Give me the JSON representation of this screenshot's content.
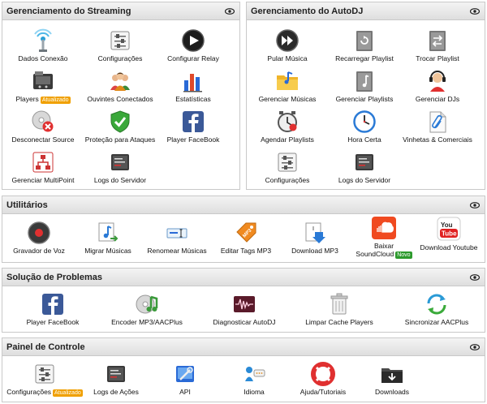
{
  "streaming": {
    "title": "Gerenciamento do Streaming",
    "items": [
      {
        "label": "Dados Conexão",
        "icon": "antenna-icon"
      },
      {
        "label": "Configurações",
        "icon": "settings-sliders-icon"
      },
      {
        "label": "Configurar Relay",
        "icon": "play-circle-icon"
      },
      {
        "label": "Players",
        "badge": "Atualizado",
        "icon": "media-player-icon"
      },
      {
        "label": "Ouvintes Conectados",
        "icon": "users-group-icon"
      },
      {
        "label": "Estatísticas",
        "icon": "bar-chart-icon"
      },
      {
        "label": "Desconectar Source",
        "icon": "disc-disconnect-icon"
      },
      {
        "label": "Proteção para Ataques",
        "icon": "shield-check-icon"
      },
      {
        "label": "Player FaceBook",
        "icon": "facebook-icon"
      },
      {
        "label": "Gerenciar MultiPoint",
        "icon": "network-icon"
      },
      {
        "label": "Logs do Servidor",
        "icon": "server-log-icon"
      }
    ]
  },
  "autodj": {
    "title": "Gerenciamento do AutoDJ",
    "items": [
      {
        "label": "Pular Música",
        "icon": "fast-forward-icon"
      },
      {
        "label": "Recarregar Playlist",
        "icon": "reload-playlist-icon"
      },
      {
        "label": "Trocar Playlist",
        "icon": "swap-playlist-icon"
      },
      {
        "label": "Gerenciar Músicas",
        "icon": "music-folder-icon"
      },
      {
        "label": "Gerenciar Playlists",
        "icon": "playlist-icon"
      },
      {
        "label": "Gerenciar DJs",
        "icon": "dj-headset-icon"
      },
      {
        "label": "Agendar Playlists",
        "icon": "schedule-clock-icon"
      },
      {
        "label": "Hora Certa",
        "icon": "clock-icon"
      },
      {
        "label": "Vinhetas & Comerciais",
        "icon": "paperclip-doc-icon"
      },
      {
        "label": "Configurações",
        "icon": "settings-sliders-icon"
      },
      {
        "label": "Logs do Servidor",
        "icon": "server-log-icon"
      }
    ]
  },
  "utilitarios": {
    "title": "Utilitários",
    "items": [
      {
        "label": "Gravador de Voz",
        "icon": "record-icon"
      },
      {
        "label": "Migrar Músicas",
        "icon": "music-note-icon"
      },
      {
        "label": "Renomear Músicas",
        "icon": "rename-icon"
      },
      {
        "label": "Editar Tags MP3",
        "icon": "mp3-tag-icon"
      },
      {
        "label": "Download MP3",
        "icon": "download-mp3-icon"
      },
      {
        "label": "Baixar",
        "label2": "SoundCloud",
        "badge": "Novo",
        "icon": "soundcloud-icon"
      },
      {
        "label": "Download Youtube",
        "icon": "youtube-icon"
      }
    ]
  },
  "problemas": {
    "title": "Solução de Problemas",
    "items": [
      {
        "label": "Player FaceBook",
        "icon": "facebook-icon"
      },
      {
        "label": "Encoder MP3/AACPlus",
        "icon": "encoder-disc-icon"
      },
      {
        "label": "Diagnosticar AutoDJ",
        "icon": "waveform-icon"
      },
      {
        "label": "Limpar Cache Players",
        "icon": "trash-icon"
      },
      {
        "label": "Sincronizar AACPlus",
        "icon": "sync-icon"
      }
    ]
  },
  "painel": {
    "title": "Painel de Controle",
    "items": [
      {
        "label": "Configurações",
        "badge": "Atualizado",
        "icon": "settings-sliders-icon"
      },
      {
        "label": "Logs de Ações",
        "icon": "server-log-icon"
      },
      {
        "label": "API",
        "icon": "api-tools-icon"
      },
      {
        "label": "Idioma",
        "icon": "language-icon"
      },
      {
        "label": "Ajuda/Tutoriais",
        "icon": "lifebuoy-icon"
      },
      {
        "label": "Downloads",
        "icon": "downloads-folder-icon"
      }
    ]
  }
}
